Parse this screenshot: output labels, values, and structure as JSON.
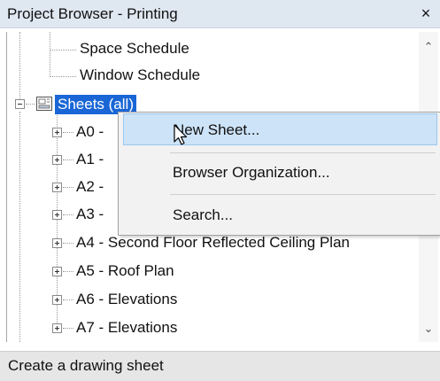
{
  "window": {
    "title": "Project Browser - Printing",
    "close_glyph": "×"
  },
  "tree": {
    "schedules": [
      {
        "label": "Space Schedule"
      },
      {
        "label": "Window Schedule"
      }
    ],
    "sheets_node": {
      "label": "Sheets (all)",
      "icon": "sheet-set-icon",
      "expanded": true
    },
    "sheets": [
      {
        "label": "A0 - "
      },
      {
        "label": "A1 - "
      },
      {
        "label": "A2 - "
      },
      {
        "label": "A3 - "
      },
      {
        "label": "A4 - Second Floor Reflected Ceiling Plan"
      },
      {
        "label": "A5 - Roof Plan"
      },
      {
        "label": "A6 - Elevations"
      },
      {
        "label": "A7 - Elevations"
      }
    ]
  },
  "context_menu": {
    "items": [
      {
        "label": "New Sheet...",
        "highlighted": true
      },
      {
        "label": "Browser Organization...",
        "highlighted": false
      },
      {
        "label": "Search...",
        "highlighted": false
      }
    ]
  },
  "status_bar": {
    "text": "Create a drawing sheet"
  },
  "colors": {
    "selection": "#1a66d6",
    "menu_hover": "#cde3f7",
    "title_bar": "#dfe7f1"
  }
}
